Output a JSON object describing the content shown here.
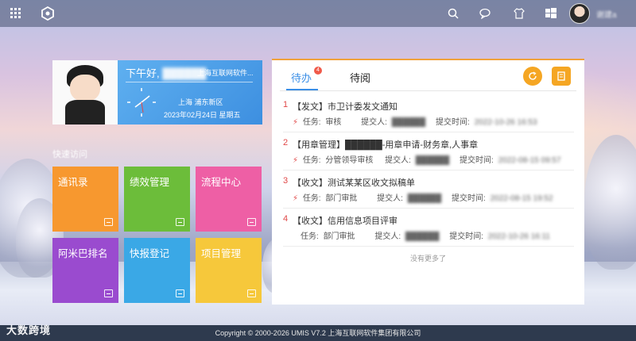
{
  "topbar": {
    "icons": [
      "grid-icon",
      "app-logo-icon",
      "search-icon",
      "message-icon",
      "theme-shirt-icon",
      "windows-icon"
    ],
    "user_name": "谢建a"
  },
  "profile": {
    "greeting": "下午好,",
    "user_name": "██████",
    "company": "上海互联网软件...",
    "location": "上海 浦东新区",
    "datetime": "2023年02月24日 星期五"
  },
  "quick_access": {
    "title": "快速访问",
    "tiles": [
      {
        "label": "通讯录",
        "color": "#f7982f"
      },
      {
        "label": "绩效管理",
        "color": "#6cbd3a"
      },
      {
        "label": "流程中心",
        "color": "#ee5fa5"
      },
      {
        "label": "阿米巴排名",
        "color": "#9a4bcf"
      },
      {
        "label": "快报登记",
        "color": "#3aa8e6"
      },
      {
        "label": "项目管理",
        "color": "#f6c83b"
      }
    ]
  },
  "tasks_panel": {
    "tabs": [
      {
        "label": "待办",
        "badge": "4",
        "active": true
      },
      {
        "label": "待阅",
        "active": false
      }
    ],
    "buttons": [
      "refresh-icon",
      "document-icon"
    ],
    "items": [
      {
        "num": "1",
        "title": "【发文】市卫计委发文通知",
        "task_label": "任务:",
        "task": "审核",
        "submitter_label": "提交人:",
        "submitter": "██████",
        "time_label": "提交时间:",
        "time": "2022-10-26 16:53"
      },
      {
        "num": "2",
        "title": "【用章管理】██████-用章申请-财务章,人事章",
        "task_label": "任务:",
        "task": "分管领导审核",
        "submitter_label": "提交人:",
        "submitter": "██████",
        "time_label": "提交时间:",
        "time": "2022-08-15 09:57"
      },
      {
        "num": "3",
        "title": "【收文】测试某某区收文拟稿单",
        "task_label": "任务:",
        "task": "部门审批",
        "submitter_label": "提交人:",
        "submitter": "██████",
        "time_label": "提交时间:",
        "time": "2022-08-15 19:52"
      },
      {
        "num": "4",
        "title": "【收文】信用信息项目评审",
        "task_label": "任务:",
        "task": "部门审批",
        "submitter_label": "提交人:",
        "submitter": "██████",
        "time_label": "提交时间:",
        "time": "2022-10-26 16:11"
      }
    ],
    "more": "没有更多了"
  },
  "footer": {
    "copyright": "Copyright © 2000-2026 UMIS V7.2 上海互联网软件集团有限公司"
  },
  "watermark": "大数跨境"
}
